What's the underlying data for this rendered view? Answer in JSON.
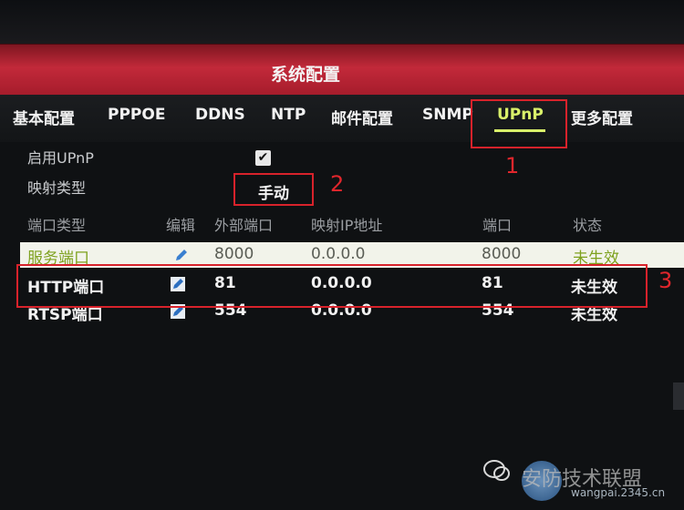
{
  "window": {
    "title": "系统配置"
  },
  "tabs": [
    {
      "label": "基本配置",
      "active": false
    },
    {
      "label": "PPPOE",
      "active": false
    },
    {
      "label": "DDNS",
      "active": false
    },
    {
      "label": "NTP",
      "active": false
    },
    {
      "label": "邮件配置",
      "active": false
    },
    {
      "label": "SNMP",
      "active": false
    },
    {
      "label": "UPnP",
      "active": true
    },
    {
      "label": "更多配置",
      "active": false
    }
  ],
  "form": {
    "enable_upnp_label": "启用UPnP",
    "enable_upnp_checked": true,
    "checkmark": "✔",
    "mapping_type_label": "映射类型",
    "mapping_type_value": "手动"
  },
  "table": {
    "headers": [
      "端口类型",
      "编辑",
      "外部端口",
      "映射IP地址",
      "端口",
      "状态"
    ],
    "rows": [
      {
        "type": "服务端口",
        "external_port": "8000",
        "ip": "0.0.0.0",
        "port": "8000",
        "status": "未生效",
        "selected": true
      },
      {
        "type": "HTTP端口",
        "external_port": "81",
        "ip": "0.0.0.0",
        "port": "81",
        "status": "未生效",
        "selected": false
      },
      {
        "type": "RTSP端口",
        "external_port": "554",
        "ip": "0.0.0.0",
        "port": "554",
        "status": "未生效",
        "selected": false
      }
    ]
  },
  "annotations": {
    "mark1": "1",
    "mark2": "2",
    "mark3": "3"
  },
  "watermark": {
    "text": "安防技术联盟",
    "url": "wangpai.2345.cn"
  },
  "colors": {
    "title_bar": "#c2293a",
    "active_tab": "#d9f06a",
    "annotation": "#d8222b",
    "status": "#7ea11e"
  },
  "icons": {
    "edit": "edit-icon",
    "checkbox": "checkbox-checked-icon"
  }
}
